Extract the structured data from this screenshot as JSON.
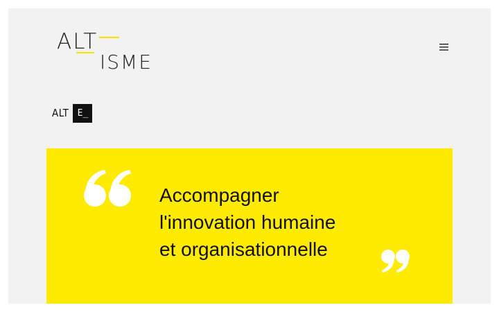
{
  "brand": {
    "logo_top": "ALT",
    "logo_bottom": "ISME",
    "accent": "#f7e017",
    "name": "ALTISME"
  },
  "header": {
    "menu_icon": "hamburger-menu-icon"
  },
  "badge": {
    "prefix": "ALT",
    "box_text": "E_"
  },
  "quote": {
    "lines": [
      "Accompagner",
      "l'innovation humaine",
      "et organisationnelle"
    ],
    "background": "#ffeb00",
    "open_icon": "open-quote-icon",
    "close_icon": "close-quote-icon"
  }
}
